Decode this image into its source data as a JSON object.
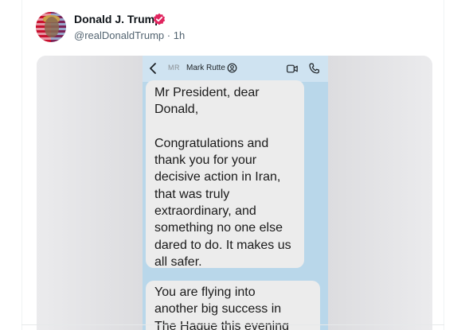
{
  "post": {
    "author_name": "Donald J. Trump",
    "handle": "@realDonaldTrump",
    "separator": "·",
    "time": "1h",
    "verified_color": "#e0245e"
  },
  "chat": {
    "avatar_initials": "MR",
    "contact_name": "Mark Rutte",
    "header_background": "#cfe3f1",
    "background": "#b9d7ea",
    "bubble_color": "#ececec",
    "messages": [
      {
        "text": "Mr President, dear\nDonald,\n\nCongratulations and\nthank you for your\ndecisive action in Iran,\nthat was truly\nextraordinary, and\nsomething no one else\ndared to do.  It makes us\nall safer."
      },
      {
        "text": "You are flying into\nanother big success in\nThe Hague this evening"
      }
    ]
  },
  "icons": {
    "back": "chevron-left-icon",
    "badge": "contact-badge-icon",
    "video": "video-call-icon",
    "call": "phone-call-icon",
    "verified": "verified-badge-icon"
  }
}
